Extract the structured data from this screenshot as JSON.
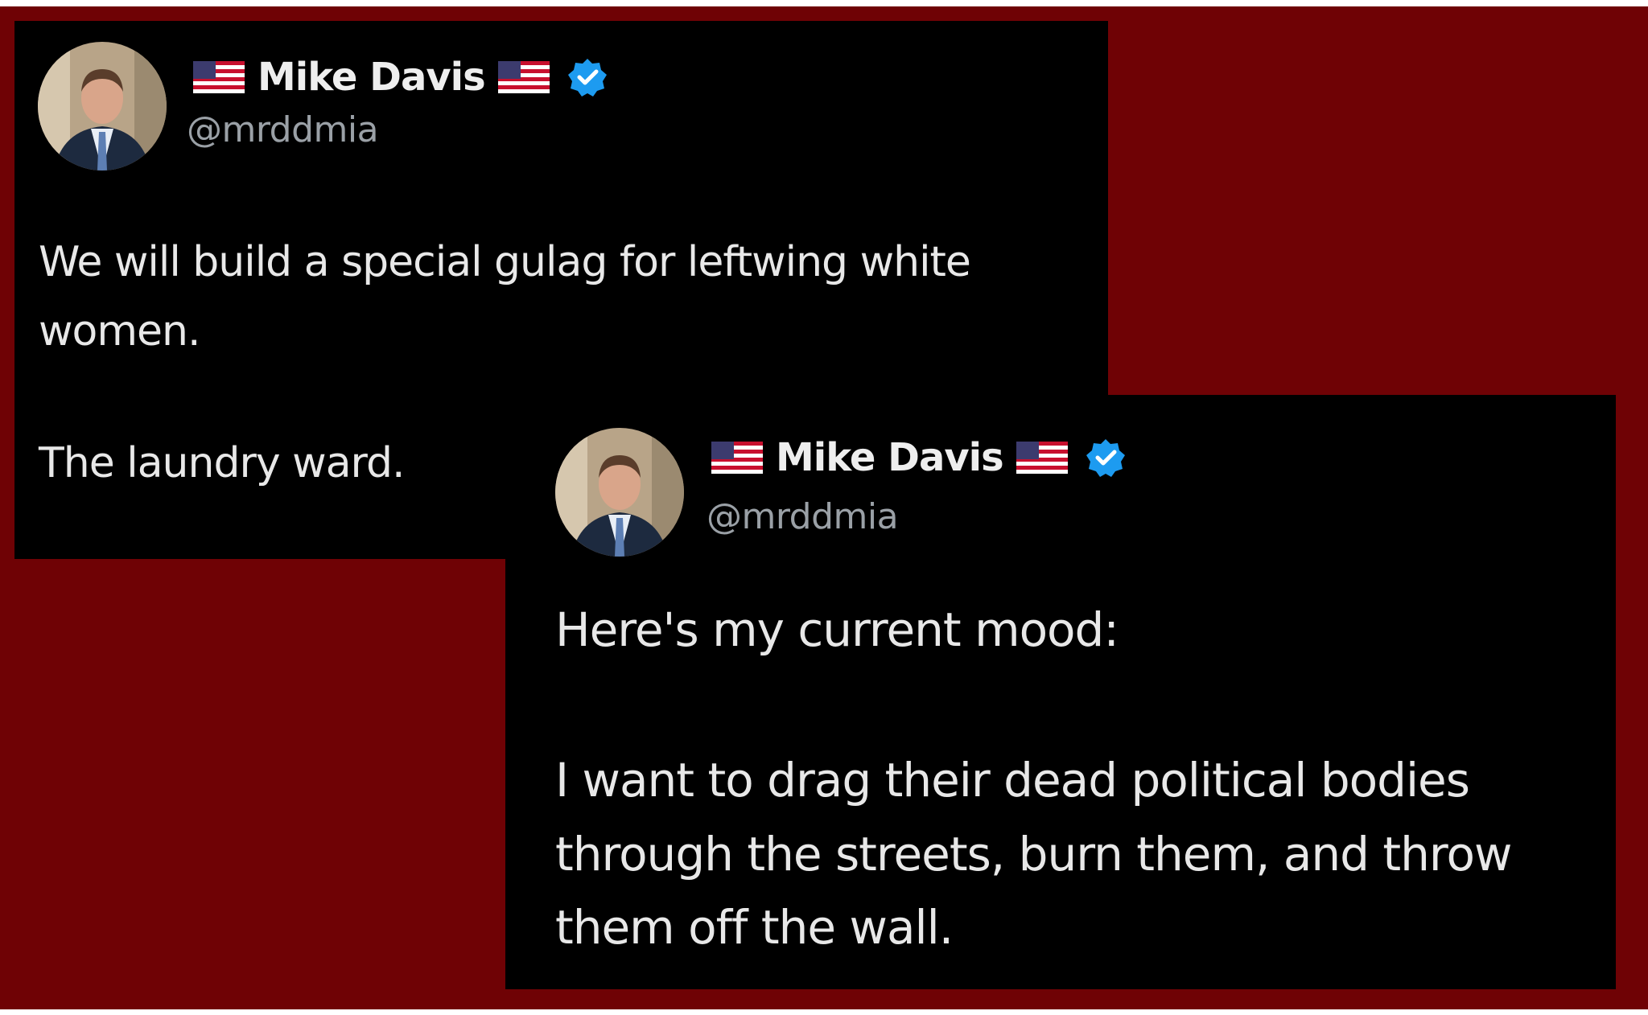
{
  "tweets": [
    {
      "display_name": "Mike Davis",
      "handle": "@mrddmia",
      "text_lines": [
        "We will build a special gulag for leftwing white",
        "women.",
        "The laundry ward."
      ]
    },
    {
      "display_name": "Mike Davis",
      "handle": "@mrddmia",
      "text_lines": [
        "Here's my current mood:",
        "I want to drag their dead political bodies",
        "through the streets, burn them, and throw",
        "them off the wall."
      ]
    }
  ],
  "icons": {
    "flag": "us-flag-icon",
    "verified": "verified-badge-icon"
  },
  "colors": {
    "background": "#6f0205",
    "card": "#000000",
    "text": "#e8e8e8",
    "handle": "#9aa0a6",
    "verified": "#1d9bf0"
  }
}
